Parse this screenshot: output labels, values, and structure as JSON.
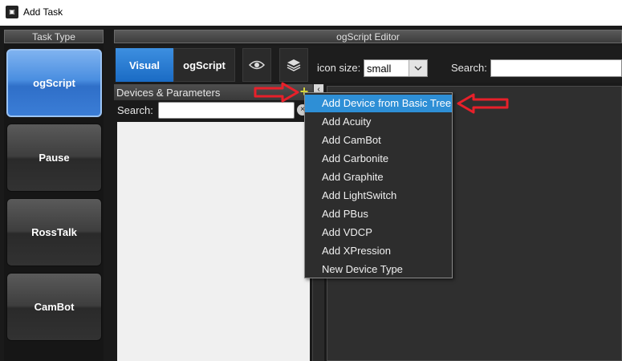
{
  "window": {
    "title": "Add Task",
    "app_icon": "ross-dashboard-icon"
  },
  "task_type": {
    "header": "Task Type",
    "items": [
      {
        "label": "ogScript",
        "active": true
      },
      {
        "label": "Pause",
        "active": false
      },
      {
        "label": "RossTalk",
        "active": false
      },
      {
        "label": "CamBot",
        "active": false
      }
    ]
  },
  "editor": {
    "header": "ogScript Editor",
    "tabs": [
      {
        "label": "Visual",
        "active": true
      },
      {
        "label": "ogScript",
        "active": false
      }
    ],
    "icon_size_label": "icon size:",
    "icon_size_value": "small",
    "search_label": "Search:"
  },
  "devices": {
    "title": "Devices & Parameters",
    "search_label": "Search:",
    "add_icon": "plus-icon"
  },
  "menu": {
    "items": [
      "Add Device from Basic Tree",
      "Add Acuity",
      "Add CamBot",
      "Add Carbonite",
      "Add Graphite",
      "Add LightSwitch",
      "Add PBus",
      "Add VDCP",
      "Add XPression",
      "New Device Type"
    ],
    "highlight_index": 0
  },
  "colors": {
    "accent": "#2e8fd6",
    "annotation_arrow": "#e8202a",
    "plus": "#d6d63a"
  }
}
